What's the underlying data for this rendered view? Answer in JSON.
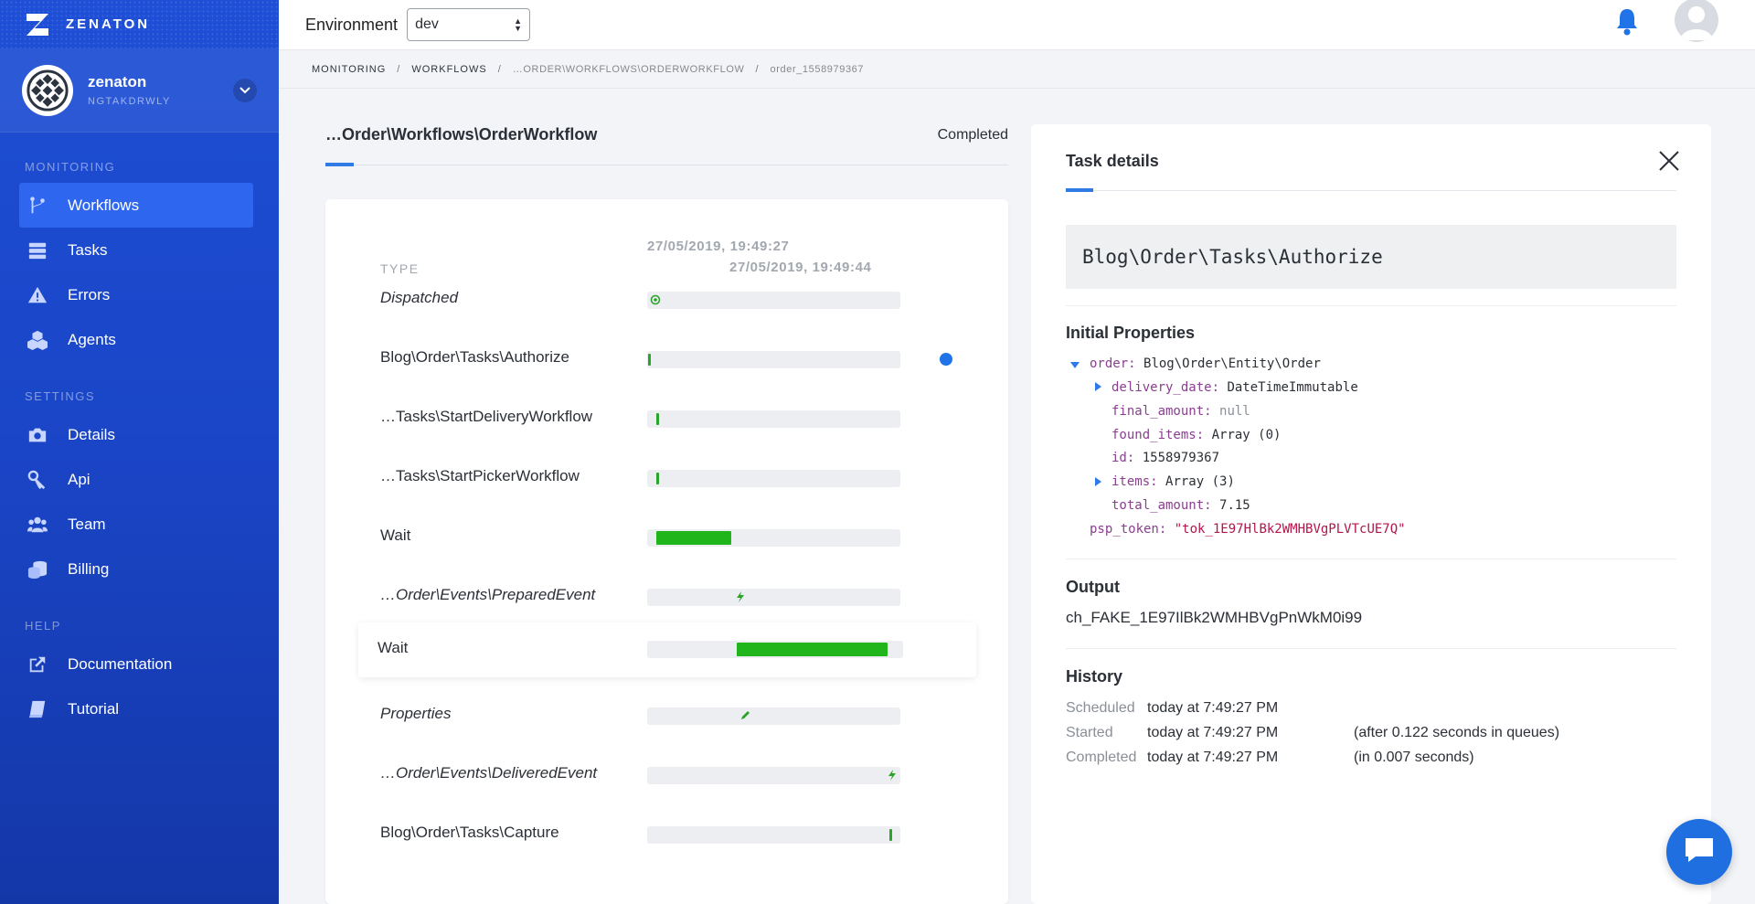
{
  "brand": {
    "name": "ZENATON"
  },
  "account": {
    "name": "zenaton",
    "id": "NGTAKDRWLY"
  },
  "nav": {
    "sections": [
      {
        "label": "MONITORING",
        "items": [
          {
            "label": "Workflows",
            "icon": "branch-icon",
            "active": true
          },
          {
            "label": "Tasks",
            "icon": "server-icon"
          },
          {
            "label": "Errors",
            "icon": "warning-icon"
          },
          {
            "label": "Agents",
            "icon": "cubes-icon"
          }
        ]
      },
      {
        "label": "SETTINGS",
        "items": [
          {
            "label": "Details",
            "icon": "camera-icon"
          },
          {
            "label": "Api",
            "icon": "key-icon"
          },
          {
            "label": "Team",
            "icon": "users-icon"
          },
          {
            "label": "Billing",
            "icon": "coins-icon"
          }
        ]
      },
      {
        "label": "HELP",
        "items": [
          {
            "label": "Documentation",
            "icon": "external-link-icon"
          },
          {
            "label": "Tutorial",
            "icon": "book-icon"
          }
        ]
      }
    ]
  },
  "topbar": {
    "env_label": "Environment",
    "env_value": "dev"
  },
  "breadcrumb": {
    "items": [
      "MONITORING",
      "WORKFLOWS",
      "…ORDER\\WORKFLOWS\\ORDERWORKFLOW",
      "order_1558979367"
    ],
    "separator": "/"
  },
  "workflow": {
    "title": "…Order\\Workflows\\OrderWorkflow",
    "status": "Completed",
    "time_start": "27/05/2019, 19:49:27",
    "time_end": "27/05/2019, 19:49:44",
    "type_header": "TYPE",
    "rows": [
      {
        "label": "Dispatched",
        "italic": true,
        "kind": "dispatch",
        "start": 0.0,
        "end": 0.0
      },
      {
        "label": "Blog\\Order\\Tasks\\Authorize",
        "italic": false,
        "kind": "tick",
        "start": 0.005,
        "end": 0.01,
        "selected": true
      },
      {
        "label": "…Tasks\\StartDeliveryWorkflow",
        "italic": false,
        "kind": "tick",
        "start": 0.035,
        "end": 0.04
      },
      {
        "label": "…Tasks\\StartPickerWorkflow",
        "italic": false,
        "kind": "tick",
        "start": 0.035,
        "end": 0.04
      },
      {
        "label": "Wait",
        "italic": false,
        "kind": "bar",
        "start": 0.035,
        "end": 0.33
      },
      {
        "label": "…Order\\Events\\PreparedEvent",
        "italic": true,
        "kind": "event",
        "start": 0.35,
        "end": 0.35
      },
      {
        "label": "Wait",
        "italic": false,
        "kind": "bar",
        "start": 0.35,
        "end": 0.94,
        "highlight": true
      },
      {
        "label": "Properties",
        "italic": true,
        "kind": "edit",
        "start": 0.37,
        "end": 0.37
      },
      {
        "label": "…Order\\Events\\DeliveredEvent",
        "italic": true,
        "kind": "event",
        "start": 0.95,
        "end": 0.95
      },
      {
        "label": "Blog\\Order\\Tasks\\Capture",
        "italic": false,
        "kind": "tick",
        "start": 0.955,
        "end": 0.965
      }
    ]
  },
  "details": {
    "title": "Task details",
    "task_name": "Blog\\Order\\Tasks\\Authorize",
    "initial_properties_title": "Initial Properties",
    "properties": {
      "order_key": "order:",
      "order_val": "Blog\\Order\\Entity\\Order",
      "delivery_date_key": "delivery_date:",
      "delivery_date_val": "DateTimeImmutable",
      "final_amount_key": "final_amount:",
      "final_amount_val": "null",
      "found_items_key": "found_items:",
      "found_items_val": "Array (0)",
      "id_key": "id:",
      "id_val": "1558979367",
      "items_key": "items:",
      "items_val": "Array (3)",
      "total_amount_key": "total_amount:",
      "total_amount_val": "7.15",
      "psp_token_key": "psp_token:",
      "psp_token_val": "\"tok_1E97HlBk2WMHBVgPLVTcUE7Q\""
    },
    "output_title": "Output",
    "output_value": "ch_FAKE_1E97IlBk2WMHBVgPnWkM0i99",
    "history_title": "History",
    "history": [
      {
        "label": "Scheduled",
        "value": "today at 7:49:27 PM",
        "note": ""
      },
      {
        "label": "Started",
        "value": "today at 7:49:27 PM",
        "note": "(after 0.122 seconds in queues)"
      },
      {
        "label": "Completed",
        "value": "today at 7:49:27 PM",
        "note": "(in 0.007 seconds)"
      }
    ]
  },
  "colors": {
    "sidebar": "#1e4fd6",
    "active_nav": "#2f66f0",
    "accent": "#2f7ae5",
    "bar": "#1fb51b"
  }
}
